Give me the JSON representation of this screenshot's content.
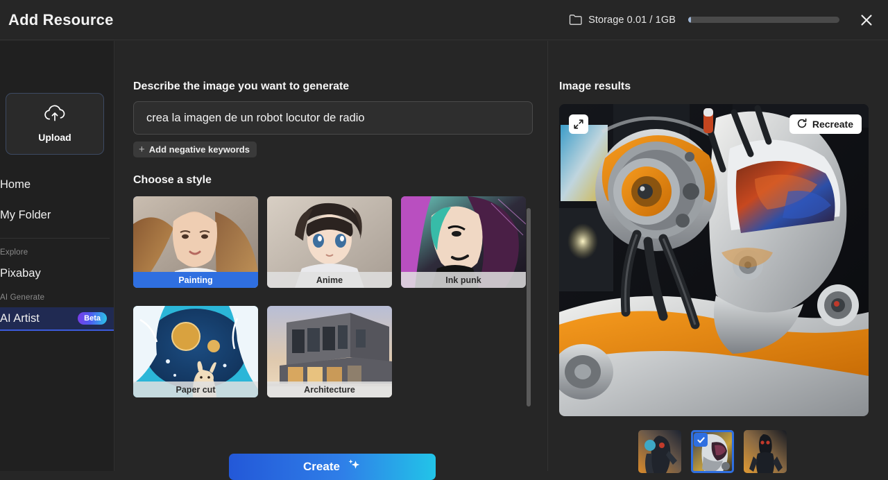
{
  "header": {
    "title": "Add Resource",
    "storage_label": "Storage 0.01 / 1GB",
    "storage_used_pct": 1,
    "folder_icon": "folder-icon",
    "close_icon": "close-icon"
  },
  "sidebar": {
    "upload": {
      "label": "Upload",
      "icon": "cloud-upload-icon"
    },
    "items": [
      {
        "label": "Home",
        "name": "home"
      },
      {
        "label": "My Folder",
        "name": "my-folder"
      }
    ],
    "explore_section": "Explore",
    "explore_items": [
      {
        "label": "Pixabay",
        "name": "pixabay"
      }
    ],
    "ai_section": "AI Generate",
    "ai_items": [
      {
        "label": "AI Artist",
        "name": "ai-artist",
        "badge": "Beta",
        "selected": true
      }
    ]
  },
  "form": {
    "describe_label": "Describe the image you want to generate",
    "prompt_value": "crea la imagen de un robot locutor de radio",
    "prompt_placeholder": "Describe the image you want to generate",
    "negative_keywords_label": "Add negative keywords",
    "negative_plus": "+",
    "style_label": "Choose a style",
    "styles": [
      {
        "label": "Painting",
        "selected": true
      },
      {
        "label": "Anime",
        "selected": false
      },
      {
        "label": "Ink punk",
        "selected": false
      },
      {
        "label": "Paper cut",
        "selected": false
      },
      {
        "label": "Architecture",
        "selected": false
      }
    ],
    "create_label": "Create",
    "create_icon": "sparkle-icon"
  },
  "results": {
    "title": "Image results",
    "expand_icon": "expand-diagonal-icon",
    "recreate_label": "Recreate",
    "recreate_icon": "refresh-icon",
    "thumbnails": [
      {
        "selected": false
      },
      {
        "selected": true
      },
      {
        "selected": false
      }
    ],
    "check_icon": "check-icon"
  },
  "colors": {
    "accent_blue": "#2f6fe0",
    "panel_bg": "#262626",
    "sidebar_bg": "#202020",
    "selected_nav_bg": "#202a52"
  }
}
